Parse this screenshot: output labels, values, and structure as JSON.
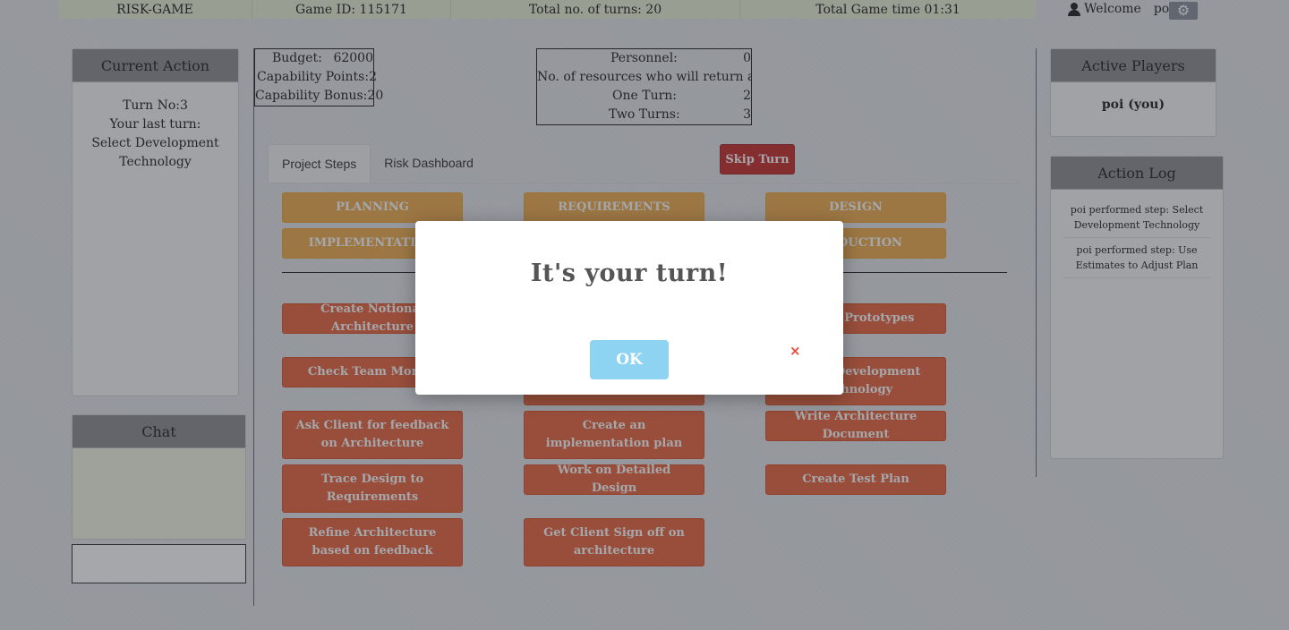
{
  "topbar": {
    "app_name": "RISK-GAME",
    "game_id": "Game ID: 115171",
    "total_turns": "Total no. of turns: 20",
    "total_time": "Total Game time 01:31"
  },
  "user": {
    "welcome": "Welcome",
    "name": "poi!"
  },
  "current_action": {
    "title": "Current Action",
    "turn": "Turn No:3",
    "last_turn_label": "Your last turn:",
    "last_turn_value": "Select Development Technology"
  },
  "chat": {
    "title": "Chat",
    "input_value": ""
  },
  "stats_left": {
    "budget_label": "Budget:",
    "budget_value": "62000",
    "cap_points_label": "Capability Points:",
    "cap_points_value": "2",
    "cap_bonus_label": "Capability Bonus:",
    "cap_bonus_value": "20"
  },
  "stats_right": {
    "personnel_label": "Personnel:",
    "personnel_value": "0",
    "return_label": "No. of resources who will return after",
    "one_turn_label": "One Turn:",
    "one_turn_value": "2",
    "two_turns_label": "Two Turns:",
    "two_turns_value": "3"
  },
  "tabs": {
    "project_steps": "Project Steps",
    "risk_dashboard": "Risk Dashboard"
  },
  "skip_turn": "Skip Turn",
  "phases": [
    "PLANNING",
    "REQUIREMENTS",
    "DESIGN",
    "IMPLEMENTATION",
    "",
    "PRODUCTION"
  ],
  "steps": [
    "Create Notional Architecture",
    "",
    "Create Prototypes",
    "Check Team Morale",
    "",
    "Select Development Technology",
    "Ask Client for feedback on Architecture",
    "Create an implementation plan",
    "Write Architecture Document",
    "Trace Design to Requirements",
    "Work on Detailed Design",
    "Create Test Plan",
    "Refine Architecture based on feedback",
    "Get Client Sign off on architecture"
  ],
  "active_players": {
    "title": "Active Players",
    "player": "poi (you)"
  },
  "action_log": {
    "title": "Action Log",
    "entries": [
      "poi performed step: Select Development Technology",
      "poi performed step: Use Estimates to Adjust Plan"
    ]
  },
  "modal": {
    "title": "It's your turn!",
    "ok": "OK",
    "close": "×"
  },
  "colors": {
    "phase": "#f0ad4e",
    "step": "#e8663f",
    "skip": "#c9302c",
    "ok": "#8ed3f2"
  }
}
